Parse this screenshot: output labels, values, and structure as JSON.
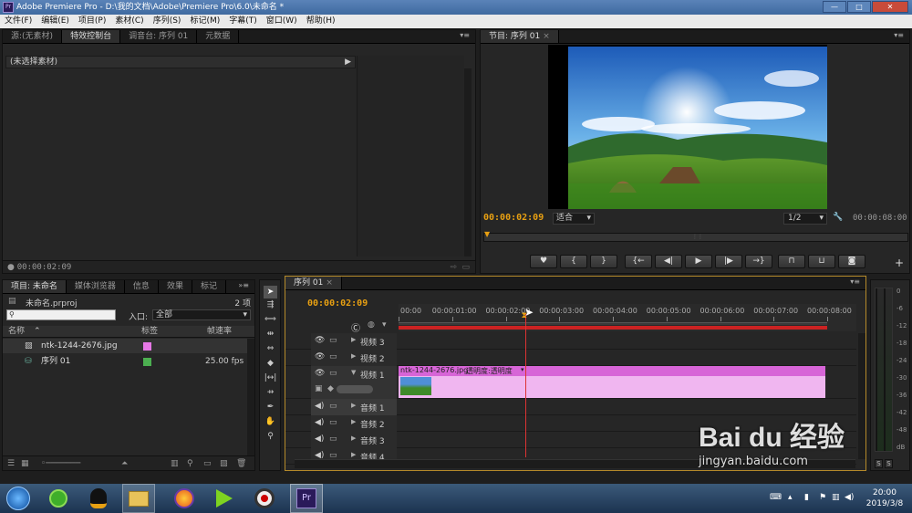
{
  "window": {
    "title": "Adobe Premiere Pro - D:\\我的文档\\Adobe\\Premiere Pro\\6.0\\未命名 *",
    "app_icon": "Pr"
  },
  "menu": [
    "文件(F)",
    "编辑(E)",
    "项目(P)",
    "素材(C)",
    "序列(S)",
    "标记(M)",
    "字幕(T)",
    "窗口(W)",
    "帮助(H)"
  ],
  "source_panel": {
    "tabs": [
      "源:(无素材)",
      "特效控制台",
      "调音台: 序列 01",
      "元数据"
    ],
    "header": "(未选择素材)",
    "timecode": "00:00:02:09"
  },
  "program_panel": {
    "tab": "节目: 序列 01",
    "timecode": "00:00:02:09",
    "fit": "适合",
    "resolution": "1/2",
    "duration": "00:00:08:00",
    "playhead_fraction": 0.0
  },
  "project_panel": {
    "tabs": [
      "项目: 未命名",
      "媒体浏览器",
      "信息",
      "效果",
      "标记"
    ],
    "project_file": "未命名.prproj",
    "item_count": "2 项",
    "entry_label": "入口:",
    "entry_value": "全部",
    "columns": [
      "名称",
      "标签",
      "帧速率"
    ],
    "items": [
      {
        "name": "ntk-1244-2676.jpg",
        "label_color": "#e678e6",
        "fps": ""
      },
      {
        "name": "序列 01",
        "label_color": "#4caf50",
        "fps": "25.00 fps"
      }
    ]
  },
  "timeline": {
    "tab": "序列 01",
    "timecode": "00:00:02:09",
    "ruler": [
      "00:00",
      "00:00:01:00",
      "00:00:02:00",
      "00:00:03:00",
      "00:00:04:00",
      "00:00:05:00",
      "00:00:06:00",
      "00:00:07:00",
      "00:00:08:00"
    ],
    "video_tracks": [
      "视频 3",
      "视频 2",
      "视频 1"
    ],
    "audio_tracks": [
      "音频 1",
      "音频 2",
      "音频 3",
      "音频 4"
    ],
    "clip": {
      "name": "ntk-1244-2676.jpg",
      "effect": "透明度:透明度"
    },
    "playhead_seconds": 2.36,
    "duration_seconds": 8
  },
  "audio_meter": {
    "labels": [
      "0",
      "-6",
      "-12",
      "-18",
      "-24",
      "-30",
      "-36",
      "-42",
      "-48",
      "dB"
    ],
    "solo": [
      "S",
      "S"
    ]
  },
  "taskbar": {
    "time": "20:00",
    "date": "2019/3/8"
  },
  "watermark": {
    "text": "Bai du 经验",
    "url": "jingyan.baidu.com"
  }
}
